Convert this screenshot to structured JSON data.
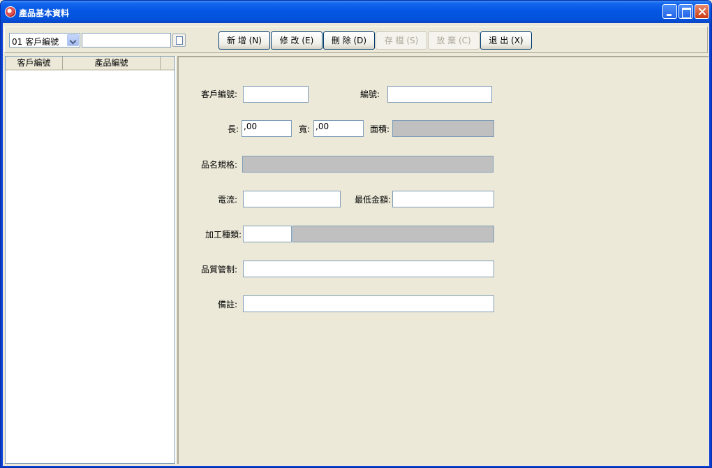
{
  "window": {
    "title": "產品基本資料"
  },
  "toolbar": {
    "field_selector": "01 客戶編號",
    "search_value": "",
    "buttons": {
      "add": "新 增 (N)",
      "edit": "修 改 (E)",
      "delete": "刪 除 (D)",
      "save": "存 檔 (S)",
      "cancel": "放 棄 (C)",
      "exit": "退 出 (X)"
    }
  },
  "list": {
    "columns": [
      "客戶編號",
      "產品編號"
    ]
  },
  "form": {
    "customer_no_label": "客戶編號:",
    "customer_no_value": "",
    "product_no_label": "編號:",
    "product_no_value": "",
    "length_label": "長:",
    "length_value": ",00",
    "width_label": "寬:",
    "width_value": ",00",
    "area_label": "面積:",
    "area_value": "",
    "spec_label": "品名規格:",
    "spec_value": "",
    "current_label": "電流:",
    "current_value": "",
    "min_amount_label": "最低金額:",
    "min_amount_value": "",
    "process_type_label": "加工種類:",
    "process_type_code": "",
    "process_type_name": "",
    "qc_label": "品質管制:",
    "qc_value": "",
    "remarks_label": "備註:",
    "remarks_value": ""
  },
  "colors": {
    "titlebar": "#0556E4",
    "background": "#ECE9D8",
    "readonly_field": "#C0C0C0",
    "field_border": "#7F9DB9",
    "button_border": "#003C74"
  }
}
